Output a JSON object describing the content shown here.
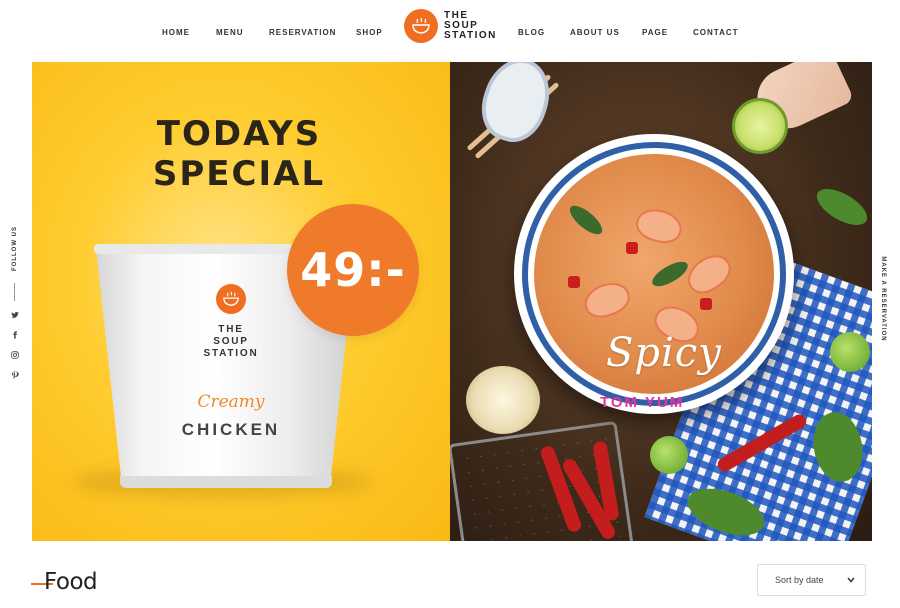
{
  "nav": {
    "left": [
      "HOME",
      "MENU",
      "RESERVATION",
      "SHOP"
    ],
    "right": [
      "BLOG",
      "ABOUT US",
      "PAGE",
      "CONTACT"
    ]
  },
  "logo": {
    "line1": "THE",
    "line2": "SOUP",
    "line3": "STATION"
  },
  "sidebar": {
    "follow_label": "FOLLOW US",
    "social_icons": [
      "twitter-icon",
      "facebook-icon",
      "instagram-icon",
      "pinterest-icon"
    ],
    "reserve_label": "MAKE A RESERVATION"
  },
  "hero_left": {
    "title_line1": "TODAYS",
    "title_line2": "SPECIAL",
    "price": "49:-",
    "cup_brand_line1": "THE",
    "cup_brand_line2": "SOUP",
    "cup_brand_line3": "STATION",
    "cup_flavor": "Creamy",
    "cup_name": "CHICKEN",
    "background_color": "#ffc623",
    "accent_color": "#ef6e21"
  },
  "hero_right": {
    "script_text": "Spicy",
    "subtitle": "TOM YUM",
    "subtitle_color": "#e8349a"
  },
  "section": {
    "title": "Food",
    "sort": {
      "selected": "Sort by date"
    }
  }
}
